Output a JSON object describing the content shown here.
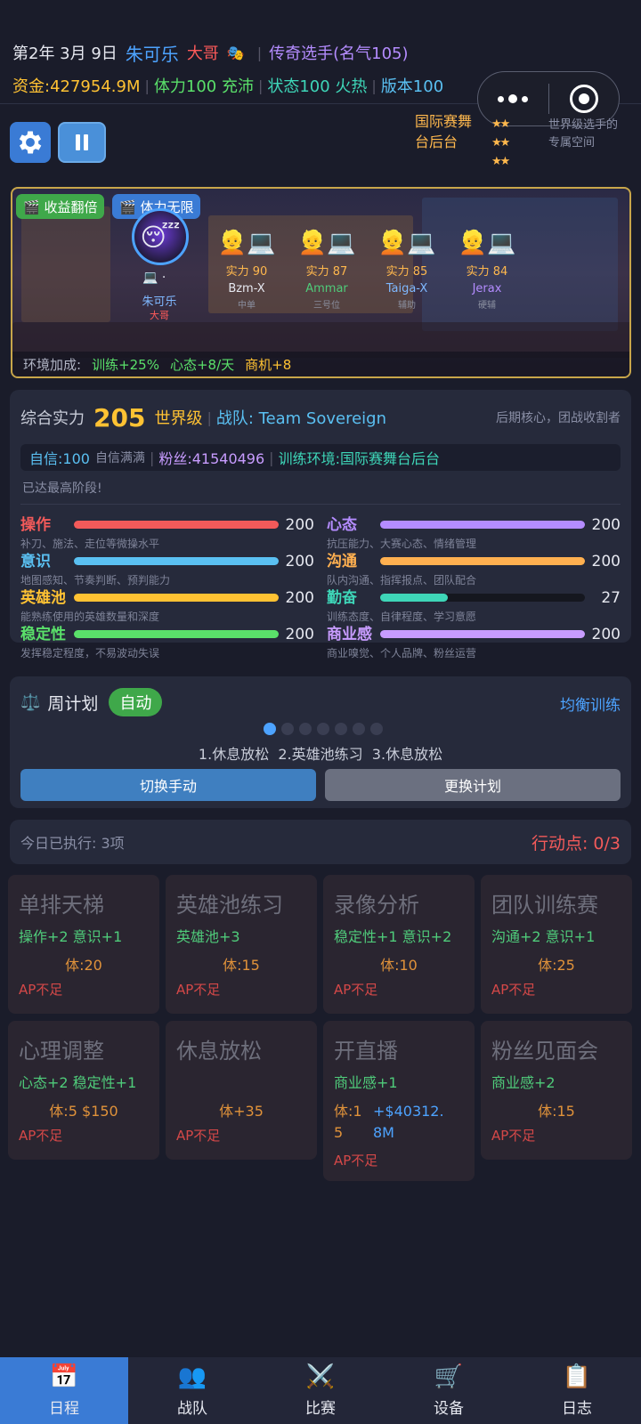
{
  "header": {
    "date": "第2年 3月 9日",
    "player_name": "朱可乐",
    "role": "大哥",
    "mask_icon": "🎭",
    "title": "传奇选手(名气105)",
    "money": "资金:427954.9M",
    "stamina": "体力100 充沛",
    "state": "状态100 火热",
    "version": "版本100"
  },
  "venue": {
    "name": "国际赛舞台后台",
    "stars": [
      "★★",
      "★★",
      "★★"
    ],
    "desc": "世界级选手的专属空间"
  },
  "scene": {
    "tag_income": "🎬 收益翻倍",
    "tag_stamina": "🎬 体力无限",
    "player": {
      "name": "朱可乐",
      "role": "大哥"
    },
    "teammates": [
      {
        "power": "实力 90",
        "name": "Bzm-X",
        "role": "中单",
        "name_color": "#e6e8f0"
      },
      {
        "power": "实力 87",
        "name": "Ammar",
        "role": "三号位",
        "name_color": "#4fcb7a"
      },
      {
        "power": "实力 85",
        "name": "Taiga-X",
        "role": "辅助",
        "name_color": "#7fb8ff"
      },
      {
        "power": "实力 84",
        "name": "Jerax",
        "role": "硬辅",
        "name_color": "#b48cff"
      }
    ],
    "env_label": "环境加成:",
    "env_train": "训练+25%",
    "env_mood": "心态+8/天",
    "env_biz": "商机+8"
  },
  "stats": {
    "overall_label": "综合实力",
    "overall_value": "205",
    "tier": "世界级",
    "team": "战队: Team Sovereign",
    "position": "后期核心，团战收割者",
    "confidence": "自信:100",
    "confidence_note": "自信满满",
    "fans": "粉丝:41540496",
    "env": "训练环境:国际赛舞台后台",
    "max_note": "已达最高阶段!",
    "items": [
      {
        "name": "操作",
        "value": "200",
        "level": 1.0,
        "desc": "补刀、施法、走位等微操水平",
        "color": "#f25a5a",
        "name_color": "#f25a5a"
      },
      {
        "name": "心态",
        "value": "200",
        "level": 1.0,
        "desc": "抗压能力、大赛心态、情绪管理",
        "color": "#b48cff",
        "name_color": "#b48cff"
      },
      {
        "name": "意识",
        "value": "200",
        "level": 1.0,
        "desc": "地图感知、节奏判断、预判能力",
        "color": "#5ac0f2",
        "name_color": "#5ac0f2"
      },
      {
        "name": "沟通",
        "value": "200",
        "level": 1.0,
        "desc": "队内沟通、指挥报点、团队配合",
        "color": "#ffb050",
        "name_color": "#ffb050"
      },
      {
        "name": "英雄池",
        "value": "200",
        "level": 1.0,
        "desc": "能熟练使用的英雄数量和深度",
        "color": "#ffc233",
        "name_color": "#ffc233"
      },
      {
        "name": "勤奋",
        "value": "27",
        "level": 0.33,
        "desc": "训练态度、自律程度、学习意愿",
        "color": "#3ed6b8",
        "name_color": "#3ed6b8"
      },
      {
        "name": "稳定性",
        "value": "200",
        "level": 1.0,
        "desc": "发挥稳定程度，不易波动失误",
        "color": "#5ae06a",
        "name_color": "#5ae06a"
      },
      {
        "name": "商业感",
        "value": "200",
        "level": 1.0,
        "desc": "商业嗅觉、个人品牌、粉丝运营",
        "color": "#c89cff",
        "name_color": "#c89cff"
      }
    ]
  },
  "plan": {
    "icon": "⚖️",
    "title": "周计划",
    "mode": "自动",
    "style": "均衡训练",
    "dots": 7,
    "active_dot": 0,
    "schedule": "1.休息放松  2.英雄池练习  3.休息放松",
    "btn_manual": "切换手动",
    "btn_change": "更换计划"
  },
  "exec": {
    "done": "今日已执行: 3项",
    "ap": "行动点: 0/3"
  },
  "actions": [
    {
      "title": "单排天梯",
      "effect": "操作+2 意识+1",
      "cost": "体:20",
      "ap": "AP不足"
    },
    {
      "title": "英雄池练习",
      "effect": "英雄池+3",
      "cost": "体:15",
      "ap": "AP不足"
    },
    {
      "title": "录像分析",
      "effect": "稳定性+1 意识+2",
      "cost": "体:10",
      "ap": "AP不足"
    },
    {
      "title": "团队训练赛",
      "effect": "沟通+2 意识+1",
      "cost": "体:25",
      "ap": "AP不足"
    },
    {
      "title": "心理调整",
      "effect": "心态+2 稳定性+1",
      "cost": "体:5 $150",
      "ap": "AP不足"
    },
    {
      "title": "休息放松",
      "effect": "",
      "cost": "体+35",
      "ap": "AP不足"
    },
    {
      "title": "开直播",
      "effect": "商业感+1",
      "cost_a": "体:15",
      "cost_b": "+$40312.8M",
      "ap": "AP不足"
    },
    {
      "title": "粉丝见面会",
      "effect": "商业感+2",
      "cost": "体:15",
      "ap": "AP不足"
    }
  ],
  "nav": [
    {
      "icon": "📅",
      "label": "日程"
    },
    {
      "icon": "👥",
      "label": "战队"
    },
    {
      "icon": "⚔️",
      "label": "比赛"
    },
    {
      "icon": "🛒",
      "label": "设备"
    },
    {
      "icon": "📋",
      "label": "日志"
    }
  ]
}
